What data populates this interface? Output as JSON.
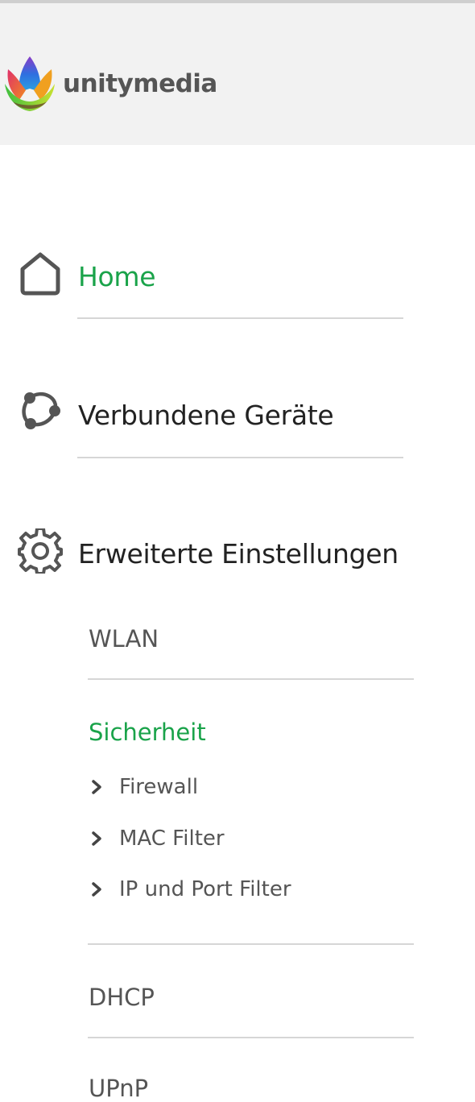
{
  "brand": {
    "name": "unitymedia"
  },
  "nav": {
    "home": {
      "label": "Home",
      "icon": "home-icon",
      "active": true
    },
    "devices": {
      "label": "Verbundene Geräte",
      "icon": "network-icon"
    },
    "advanced": {
      "label": "Erweiterte Einstellungen",
      "icon": "gear-icon"
    }
  },
  "advanced_menu": {
    "wlan": "WLAN",
    "security": "Sicherheit",
    "security_children": [
      "Firewall",
      "MAC Filter",
      "IP und Port Filter"
    ],
    "dhcp": "DHCP",
    "upnp": "UPnP"
  },
  "colors": {
    "accent": "#1aa34a",
    "header_bg": "#f2f2f2",
    "text_dark": "#222222",
    "text_grey": "#555555",
    "divider": "#d6d6d6"
  }
}
